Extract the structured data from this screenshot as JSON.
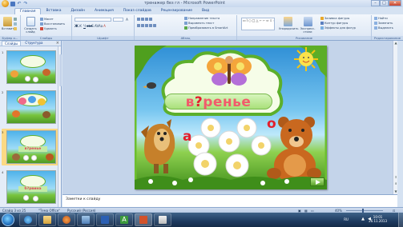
{
  "window": {
    "title": "тренажер без гл - Microsoft PowerPoint",
    "minimize": "–",
    "maximize": "□",
    "close": "✕"
  },
  "ribbon_tabs": [
    {
      "label": "Главная",
      "active": true
    },
    {
      "label": "Вставка",
      "active": false
    },
    {
      "label": "Дизайн",
      "active": false
    },
    {
      "label": "Анимация",
      "active": false
    },
    {
      "label": "Показ слайдов",
      "active": false
    },
    {
      "label": "Рецензирование",
      "active": false
    },
    {
      "label": "Вид",
      "active": false
    }
  ],
  "ribbon": {
    "clipboard": {
      "label": "Буфер о...",
      "paste": "Вставить"
    },
    "slides": {
      "label": "Слайды",
      "new_slide": "Создать слайд",
      "layout": "Макет",
      "reset": "Восстановить",
      "delete": "Удалить"
    },
    "font": {
      "label": "Шрифт"
    },
    "paragraph": {
      "label": "Абзац",
      "direction": "Направление текста",
      "align": "Выровнять текст",
      "smartart": "Преобразовать в SmartArt"
    },
    "drawing": {
      "label": "Рисование",
      "arrange": "Упорядочить",
      "quick_styles": "Экспресс-стили",
      "fill": "Заливка фигуры",
      "outline": "Контур фигуры",
      "effects": "Эффекты для фигур",
      "shapes_glyphs": "▭\\○□△⌐⌐⇨⇩☆{}"
    },
    "editing": {
      "label": "Редактирование",
      "find": "Найти",
      "replace": "Заменить",
      "select": "Выделить"
    }
  },
  "left_pane": {
    "tabs": [
      {
        "label": "Слайды",
        "active": true
      },
      {
        "label": "Структура",
        "active": false
      }
    ],
    "close": "×",
    "thumbnails": [
      {
        "num": "1",
        "word": "",
        "selected": false
      },
      {
        "num": "2",
        "word": "",
        "selected": false
      },
      {
        "num": "3",
        "word": "в?ренье",
        "selected": true
      },
      {
        "num": "4",
        "word": "б?рвина",
        "selected": false
      }
    ]
  },
  "slide": {
    "word_prefix": "в",
    "word_gap": "?",
    "word_suffix": "ренье",
    "option_left": "а",
    "option_right": "о"
  },
  "notes": {
    "placeholder": "Заметки к слайду"
  },
  "status": {
    "slide": "Слайд 3 из 25",
    "theme": "\"Тема Office\"",
    "language": "Русский (Россия)",
    "zoom": "40%"
  },
  "taskbar": {
    "lang": "RU",
    "time": "10:01",
    "date": "26.11.2013"
  }
}
